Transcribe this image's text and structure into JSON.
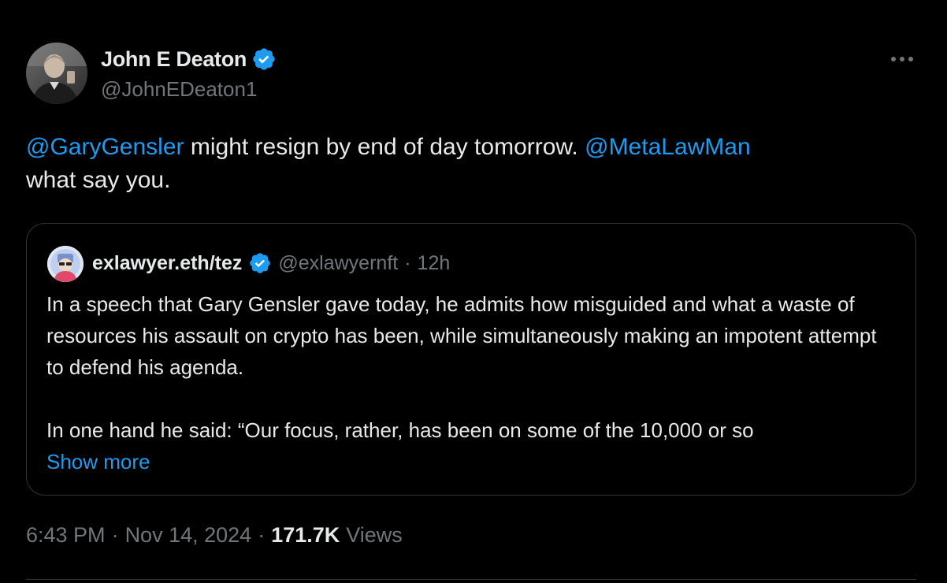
{
  "author": {
    "name": "John E Deaton",
    "handle": "@JohnEDeaton1",
    "verified_icon": "verified-badge-icon",
    "accent": "#1d9bf0"
  },
  "more_icon": "more-options-icon",
  "tweet": {
    "mention_1": "@GaryGensler",
    "text_1": " might resign by end of day tomorrow. ",
    "mention_2": "@MetaLawMan",
    "text_2": " what say you."
  },
  "quote": {
    "name": "exlawyer.eth/tez",
    "handle": "@exlawyernft",
    "separator": "·",
    "time": "12h",
    "paragraph_1": "In a speech that Gary Gensler gave today, he admits how misguided and what a waste of resources his assault on crypto has been, while simultaneously making an impotent attempt to defend his agenda.",
    "paragraph_2": "In one hand he said: “Our focus, rather, has been on some of the 10,000 or so",
    "show_more": "Show more"
  },
  "meta": {
    "time": "6:43 PM",
    "sep_1": "·",
    "date": "Nov 14, 2024",
    "sep_2": "·",
    "views_count": "171.7K",
    "views_label": "Views"
  },
  "colors": {
    "background": "#000000",
    "text": "#e7e9ea",
    "muted": "#71767b",
    "link": "#1d9bf0",
    "border": "#2f3336"
  }
}
